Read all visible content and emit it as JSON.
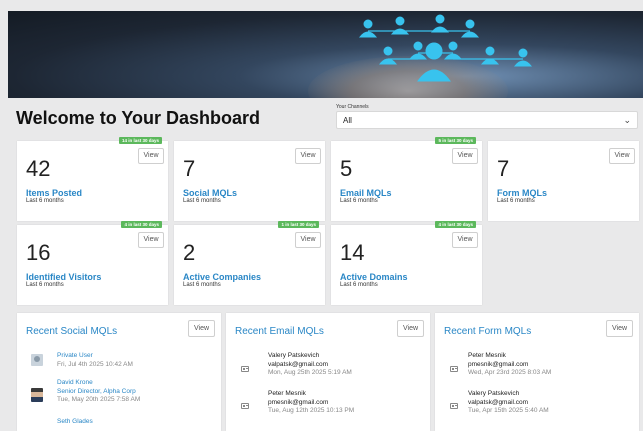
{
  "header": {
    "welcome": "Welcome to Your Dashboard",
    "channels_label": "Your Channels",
    "channels_value": "All"
  },
  "colors": {
    "accent": "#2a87c6",
    "badge": "#5cb85c"
  },
  "cards": [
    {
      "number": "42",
      "title": "Items Posted",
      "sub": "Last 6 months",
      "badge": "14 in last 30 days",
      "view": "View"
    },
    {
      "number": "7",
      "title": "Social MQLs",
      "sub": "Last 6 months",
      "badge": "",
      "view": "View"
    },
    {
      "number": "5",
      "title": "Email MQLs",
      "sub": "Last 6 months",
      "badge": "5 in last 30 days",
      "view": "View"
    },
    {
      "number": "7",
      "title": "Form MQLs",
      "sub": "Last 6 months",
      "badge": "",
      "view": "View"
    },
    {
      "number": "16",
      "title": "Identified Visitors",
      "sub": "Last 6 months",
      "badge": "4 in last 30 days",
      "view": "View"
    },
    {
      "number": "2",
      "title": "Active Companies",
      "sub": "Last 6 months",
      "badge": "1 in last 30 days",
      "view": "View"
    },
    {
      "number": "14",
      "title": "Active Domains",
      "sub": "Last 6 months",
      "badge": "4 in last 30 days",
      "view": "View"
    }
  ],
  "social": {
    "title": "Recent Social MQLs",
    "view": "View",
    "items": [
      {
        "name": "Private User",
        "time": "Fri, Jul 4th 2025 10:42 AM"
      },
      {
        "name": "David Krone",
        "role": "Senior Director, Alpha Corp",
        "time": "Tue, May 20th 2025 7:58 AM"
      },
      {
        "name": "Seth Glades"
      }
    ]
  },
  "email": {
    "title": "Recent Email MQLs",
    "view": "View",
    "items": [
      {
        "name": "Valery Patskevich",
        "email": "valpatsk@gmail.com",
        "time": "Mon, Aug 25th 2025 5:19 AM"
      },
      {
        "name": "Peter Mesnik",
        "email": "pmesnik@gmail.com",
        "time": "Tue, Aug 12th 2025 10:13 PM"
      }
    ]
  },
  "form": {
    "title": "Recent Form MQLs",
    "view": "View",
    "items": [
      {
        "name": "Peter Mesnik",
        "email": "pmesnik@gmail.com",
        "time": "Wed, Apr 23rd 2025 8:03 AM"
      },
      {
        "name": "Valery Patskevich",
        "email": "valpatsk@gmail.com",
        "time": "Tue, Apr 15th 2025 5:40 AM"
      }
    ]
  }
}
